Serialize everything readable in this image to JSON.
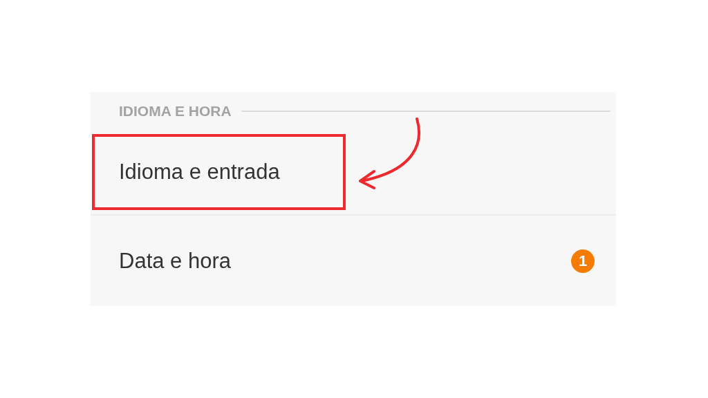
{
  "section": {
    "title": "IDIOMA E HORA",
    "items": [
      {
        "label": "Idioma e entrada",
        "highlighted": true
      },
      {
        "label": "Data e hora",
        "highlighted": false,
        "badge": "1"
      }
    ]
  }
}
